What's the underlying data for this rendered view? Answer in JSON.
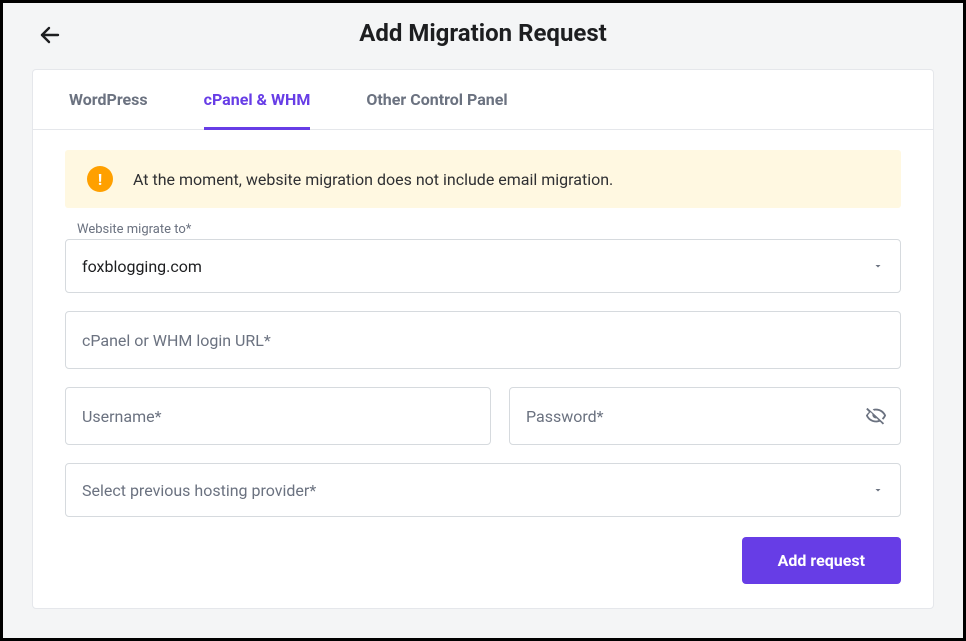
{
  "header": {
    "title": "Add Migration Request"
  },
  "tabs": {
    "items": [
      {
        "label": "WordPress"
      },
      {
        "label": "cPanel & WHM"
      },
      {
        "label": "Other Control Panel"
      }
    ],
    "active_index": 1
  },
  "notice": {
    "text": "At the moment, website migration does not include email migration."
  },
  "form": {
    "migrate_to_label": "Website migrate to*",
    "migrate_to_value": "foxblogging.com",
    "login_url_placeholder": "cPanel or WHM login URL*",
    "username_placeholder": "Username*",
    "password_placeholder": "Password*",
    "provider_placeholder": "Select previous hosting provider*"
  },
  "actions": {
    "submit_label": "Add request"
  }
}
